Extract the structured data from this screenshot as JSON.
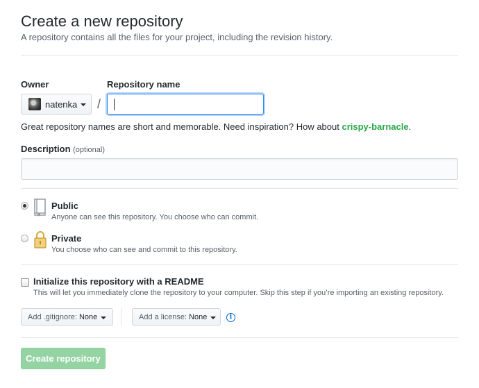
{
  "header": {
    "title": "Create a new repository",
    "subtitle": "A repository contains all the files for your project, including the revision history."
  },
  "owner": {
    "label": "Owner",
    "name": "natenka"
  },
  "repository": {
    "label": "Repository name",
    "value": "",
    "separator": "/",
    "hint_prefix": "Great repository names are short and memorable. Need inspiration? How about ",
    "suggestion": "crispy-barnacle",
    "hint_suffix": "."
  },
  "description": {
    "label": "Description",
    "optional": "(optional)",
    "value": ""
  },
  "visibility": {
    "selected": "Public",
    "options": [
      {
        "title": "Public",
        "note": "Anyone can see this repository. You choose who can commit.",
        "icon": "repo-icon"
      },
      {
        "title": "Private",
        "note": "You choose who can see and commit to this repository.",
        "icon": "lock-icon"
      }
    ]
  },
  "init": {
    "label": "Initialize this repository with a README",
    "note": "This will let you immediately clone the repository to your computer. Skip this step if you’re importing an existing repository.",
    "checked": false
  },
  "gitignore": {
    "label": "Add .gitignore:",
    "value": "None"
  },
  "license": {
    "label": "Add a license:",
    "value": "None"
  },
  "submit": {
    "label": "Create repository"
  },
  "colors": {
    "accent_blue": "#0366d6",
    "suggestion_green": "#28a745",
    "disabled_button": "#94d3a2"
  }
}
